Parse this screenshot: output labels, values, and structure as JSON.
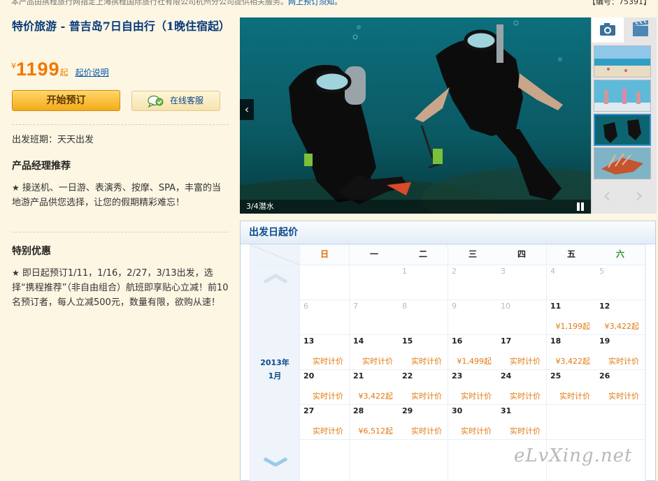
{
  "top_notice": {
    "text": "本产品由携程旅行网指定上海携程国际旅行社有限公司杭州分公司提供相关服务。",
    "link": "网上预订须知。"
  },
  "product_code": "【编号：75391】",
  "product": {
    "title": "特价旅游 - 普吉岛7日自由行（1晚住宿起）",
    "currency": "¥",
    "price": "1199",
    "price_suffix": "起",
    "price_explain": "起价说明",
    "book_button": "开始预订",
    "service_button": "在线客服",
    "departure": "出发班期：天天出发",
    "manager_heading": "产品经理推荐",
    "manager_text": "接送机、一日游、表演秀、按摩、SPA，丰富的当地游产品供您选择，让您的假期精彩难忘！",
    "offer_heading": "特别优惠",
    "offer_text": "即日起预订1/11，1/16，2/27，3/13出发，选择“携程推荐”（非自由组合）航班即享贴心立减！前10名预订者，每人立减500元，数量有限，欲购从速！"
  },
  "gallery": {
    "caption": "3/4潜水",
    "tabs": [
      "camera-icon",
      "video-icon"
    ],
    "thumbnails": [
      "beach",
      "beach-people",
      "diving",
      "lionfish"
    ],
    "selected_thumbnail": 2
  },
  "calendar": {
    "heading": "出发日起价",
    "month_year": "2013年",
    "month": "1月",
    "weekdays": [
      "日",
      "一",
      "二",
      "三",
      "四",
      "五",
      "六"
    ],
    "weeks": [
      [
        {
          "day": "",
          "price": ""
        },
        {
          "day": "",
          "price": ""
        },
        {
          "day": "1",
          "price": "",
          "past": true
        },
        {
          "day": "2",
          "price": "",
          "past": true
        },
        {
          "day": "3",
          "price": "",
          "past": true
        },
        {
          "day": "4",
          "price": "",
          "past": true
        },
        {
          "day": "5",
          "price": "",
          "past": true
        }
      ],
      [
        {
          "day": "6",
          "price": "",
          "past": true
        },
        {
          "day": "7",
          "price": "",
          "past": true
        },
        {
          "day": "8",
          "price": "",
          "past": true
        },
        {
          "day": "9",
          "price": "",
          "past": true
        },
        {
          "day": "10",
          "price": "",
          "past": true
        },
        {
          "day": "11",
          "price": "¥1,199起"
        },
        {
          "day": "12",
          "price": "¥3,422起"
        }
      ],
      [
        {
          "day": "13",
          "price": "实时计价"
        },
        {
          "day": "14",
          "price": "实时计价"
        },
        {
          "day": "15",
          "price": "实时计价"
        },
        {
          "day": "16",
          "price": "¥1,499起"
        },
        {
          "day": "17",
          "price": "实时计价"
        },
        {
          "day": "18",
          "price": "¥3,422起"
        },
        {
          "day": "19",
          "price": "实时计价"
        }
      ],
      [
        {
          "day": "20",
          "price": "实时计价"
        },
        {
          "day": "21",
          "price": "¥3,422起"
        },
        {
          "day": "22",
          "price": "实时计价"
        },
        {
          "day": "23",
          "price": "实时计价"
        },
        {
          "day": "24",
          "price": "实时计价"
        },
        {
          "day": "25",
          "price": "实时计价"
        },
        {
          "day": "26",
          "price": "实时计价"
        }
      ],
      [
        {
          "day": "27",
          "price": "实时计价"
        },
        {
          "day": "28",
          "price": "¥6,512起"
        },
        {
          "day": "29",
          "price": "实时计价"
        },
        {
          "day": "30",
          "price": "实时计价"
        },
        {
          "day": "31",
          "price": "实时计价"
        },
        {
          "day": "",
          "price": ""
        },
        {
          "day": "",
          "price": ""
        }
      ],
      [
        {
          "day": "",
          "price": ""
        },
        {
          "day": "",
          "price": ""
        },
        {
          "day": "",
          "price": ""
        },
        {
          "day": "",
          "price": ""
        },
        {
          "day": "",
          "price": ""
        },
        {
          "day": "",
          "price": ""
        },
        {
          "day": "",
          "price": ""
        }
      ]
    ]
  },
  "watermark": "eLvXing.net",
  "colors": {
    "accent_orange": "#f07800",
    "link_blue": "#0055aa",
    "title_blue": "#063a7a",
    "page_bg": "#fdf6e3"
  }
}
